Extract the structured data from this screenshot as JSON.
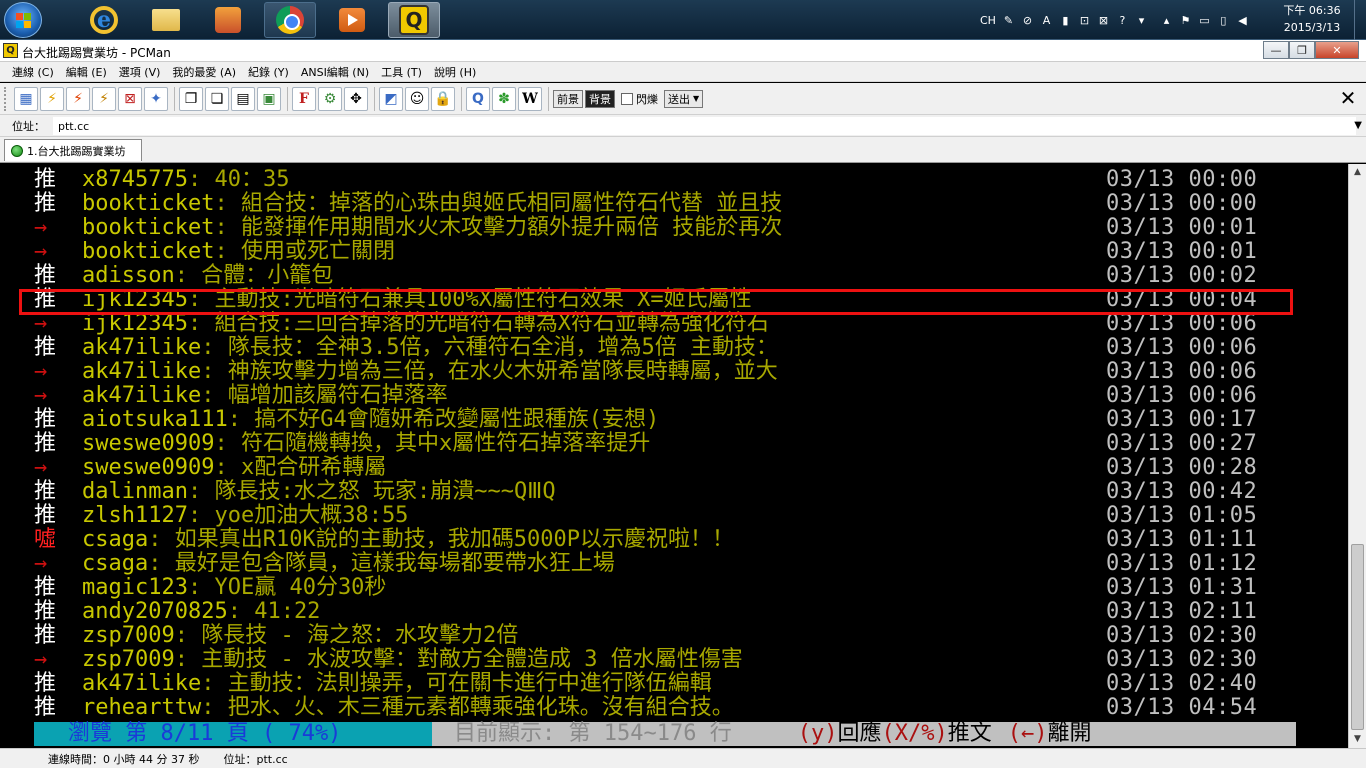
{
  "taskbar": {
    "clock_time": "下午 06:36",
    "clock_date": "2015/3/13",
    "lang": "CH"
  },
  "window": {
    "title": "台大批踢踢實業坊 - PCMan"
  },
  "menu": [
    "連線 (C)",
    "編輯 (E)",
    "選項 (V)",
    "我的最愛 (A)",
    "紀錄 (Y)",
    "ANSI編輯 (N)",
    "工具 (T)",
    "說明 (H)"
  ],
  "toolbar": {
    "fg_label": "前景",
    "bg_label": "背景",
    "blink_label": "閃爍",
    "send_label": "送出"
  },
  "address": {
    "label": "位址：",
    "value": "ptt.cc"
  },
  "tab": {
    "label": "1.台大批踢踢實業坊"
  },
  "comments": [
    {
      "tag": "推",
      "type": "push",
      "user": "x8745775",
      "text": "40：35",
      "time": "03/13 00:00"
    },
    {
      "tag": "推",
      "type": "push",
      "user": "bookticket",
      "text": "組合技：掉落的心珠由與姬氏相同屬性符石代替 並且技",
      "time": "03/13 00:00"
    },
    {
      "tag": "→",
      "type": "arrow",
      "user": "bookticket",
      "text": "能發揮作用期間水火木攻擊力額外提升兩倍 技能於再次",
      "time": "03/13 00:01"
    },
    {
      "tag": "→",
      "type": "arrow",
      "user": "bookticket",
      "text": "使用或死亡關閉",
      "time": "03/13 00:01"
    },
    {
      "tag": "推",
      "type": "push",
      "user": "adisson",
      "text": "合體：小籠包",
      "time": "03/13 00:02"
    },
    {
      "tag": "推",
      "type": "push",
      "user": "ijk12345",
      "text": "主動技:光暗符石兼具100%X屬性符石效果 X=姬氏屬性",
      "time": "03/13 00:04"
    },
    {
      "tag": "→",
      "type": "arrow",
      "user": "ijk12345",
      "text": "組合技:三回合掉落的光暗符石轉為X符石並轉為強化符石",
      "time": "03/13 00:06"
    },
    {
      "tag": "推",
      "type": "push",
      "user": "ak47ilike",
      "text": "隊長技：全神3.5倍，六種符石全消，增為5倍 主動技：",
      "time": "03/13 00:06"
    },
    {
      "tag": "→",
      "type": "arrow",
      "user": "ak47ilike",
      "text": "神族攻擊力增為三倍，在水火木妍希當隊長時轉屬，並大",
      "time": "03/13 00:06"
    },
    {
      "tag": "→",
      "type": "arrow",
      "user": "ak47ilike",
      "text": "幅增加該屬符石掉落率",
      "time": "03/13 00:06"
    },
    {
      "tag": "推",
      "type": "push",
      "user": "aiotsuka111",
      "text": "搞不好G4會隨妍希改變屬性跟種族(妄想)",
      "time": "03/13 00:17"
    },
    {
      "tag": "推",
      "type": "push",
      "user": "sweswe0909",
      "text": "符石隨機轉換，其中x屬性符石掉落率提升",
      "time": "03/13 00:27"
    },
    {
      "tag": "→",
      "type": "arrow",
      "user": "sweswe0909",
      "text": "x配合研希轉屬",
      "time": "03/13 00:28"
    },
    {
      "tag": "推",
      "type": "push",
      "user": "dalinman",
      "text": "隊長技:水之怒 玩家:崩潰~~~QⅢQ",
      "time": "03/13 00:42"
    },
    {
      "tag": "推",
      "type": "push",
      "user": "zlsh1127",
      "text": "yoe加油大概38:55",
      "time": "03/13 01:05"
    },
    {
      "tag": "噓",
      "type": "boo",
      "user": "csaga",
      "text": "如果真出R10K說的主動技，我加碼5000P以示慶祝啦！！",
      "time": "03/13 01:11"
    },
    {
      "tag": "→",
      "type": "arrow",
      "user": "csaga",
      "text": "最好是包含隊員，這樣我每場都要帶水狂上場",
      "time": "03/13 01:12"
    },
    {
      "tag": "推",
      "type": "push",
      "user": "magic123",
      "text": "YOE贏  40分30秒",
      "time": "03/13 01:31"
    },
    {
      "tag": "推",
      "type": "push",
      "user": "andy2070825",
      "text": "41:22",
      "time": "03/13 02:11"
    },
    {
      "tag": "推",
      "type": "push",
      "user": "zsp7009",
      "text": "隊長技 - 海之怒：水攻擊力2倍",
      "time": "03/13 02:30"
    },
    {
      "tag": "→",
      "type": "arrow",
      "user": "zsp7009",
      "text": "主動技 - 水波攻擊：對敵方全體造成 3 倍水屬性傷害",
      "time": "03/13 02:30"
    },
    {
      "tag": "推",
      "type": "push",
      "user": "ak47ilike",
      "text": "主動技：法則操弄，可在關卡進行中進行隊伍編輯",
      "time": "03/13 02:40"
    },
    {
      "tag": "推",
      "type": "push",
      "user": "rehearttw",
      "text": "把水、火、木三種元素都轉乘強化珠。沒有組合技。",
      "time": "03/13 04:54"
    }
  ],
  "status": {
    "browse": "瀏覽 第 8/11 頁 ( 74%)",
    "showing": "目前顯示: 第 154~176 行",
    "reply_key": "(y)",
    "reply_label": "回應",
    "push_key": "(X/%)",
    "push_label": "推文",
    "leave_key": "(←)",
    "leave_label": "離開"
  },
  "statusbar": {
    "connected": "連線時間：0 小時 44 分 37 秒",
    "address": "位址：ptt.cc"
  }
}
